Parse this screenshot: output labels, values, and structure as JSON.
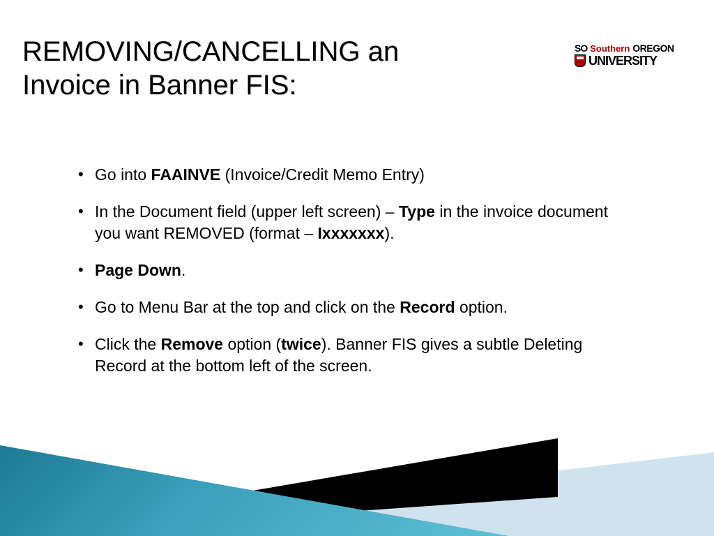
{
  "title": "REMOVING/CANCELLING an Invoice in Banner FIS:",
  "logo": {
    "so": "SO",
    "southern": "Southern",
    "oregon": "OREGON",
    "university": "UNIVERSITY"
  },
  "bullets": [
    {
      "parts": [
        {
          "t": "Go into "
        },
        {
          "t": "FAAINVE",
          "b": true
        },
        {
          "t": " (Invoice/Credit Memo Entry)"
        }
      ]
    },
    {
      "parts": [
        {
          "t": "In the Document field (upper left screen) – "
        },
        {
          "t": "Type",
          "b": true
        },
        {
          "t": " in the invoice document you want REMOVED (format – "
        },
        {
          "t": "Ixxxxxxx",
          "b": true
        },
        {
          "t": ")."
        }
      ]
    },
    {
      "parts": [
        {
          "t": "Page Down",
          "b": true
        },
        {
          "t": "."
        }
      ]
    },
    {
      "parts": [
        {
          "t": "Go to Menu Bar at the top and click on the "
        },
        {
          "t": "Record",
          "b": true
        },
        {
          "t": " option."
        }
      ]
    },
    {
      "parts": [
        {
          "t": "Click the "
        },
        {
          "t": "Remove",
          "b": true
        },
        {
          "t": " option ("
        },
        {
          "t": "twice",
          "b": true
        },
        {
          "t": ").  Banner FIS gives a subtle Deleting Record at the bottom left of the screen."
        }
      ]
    }
  ]
}
